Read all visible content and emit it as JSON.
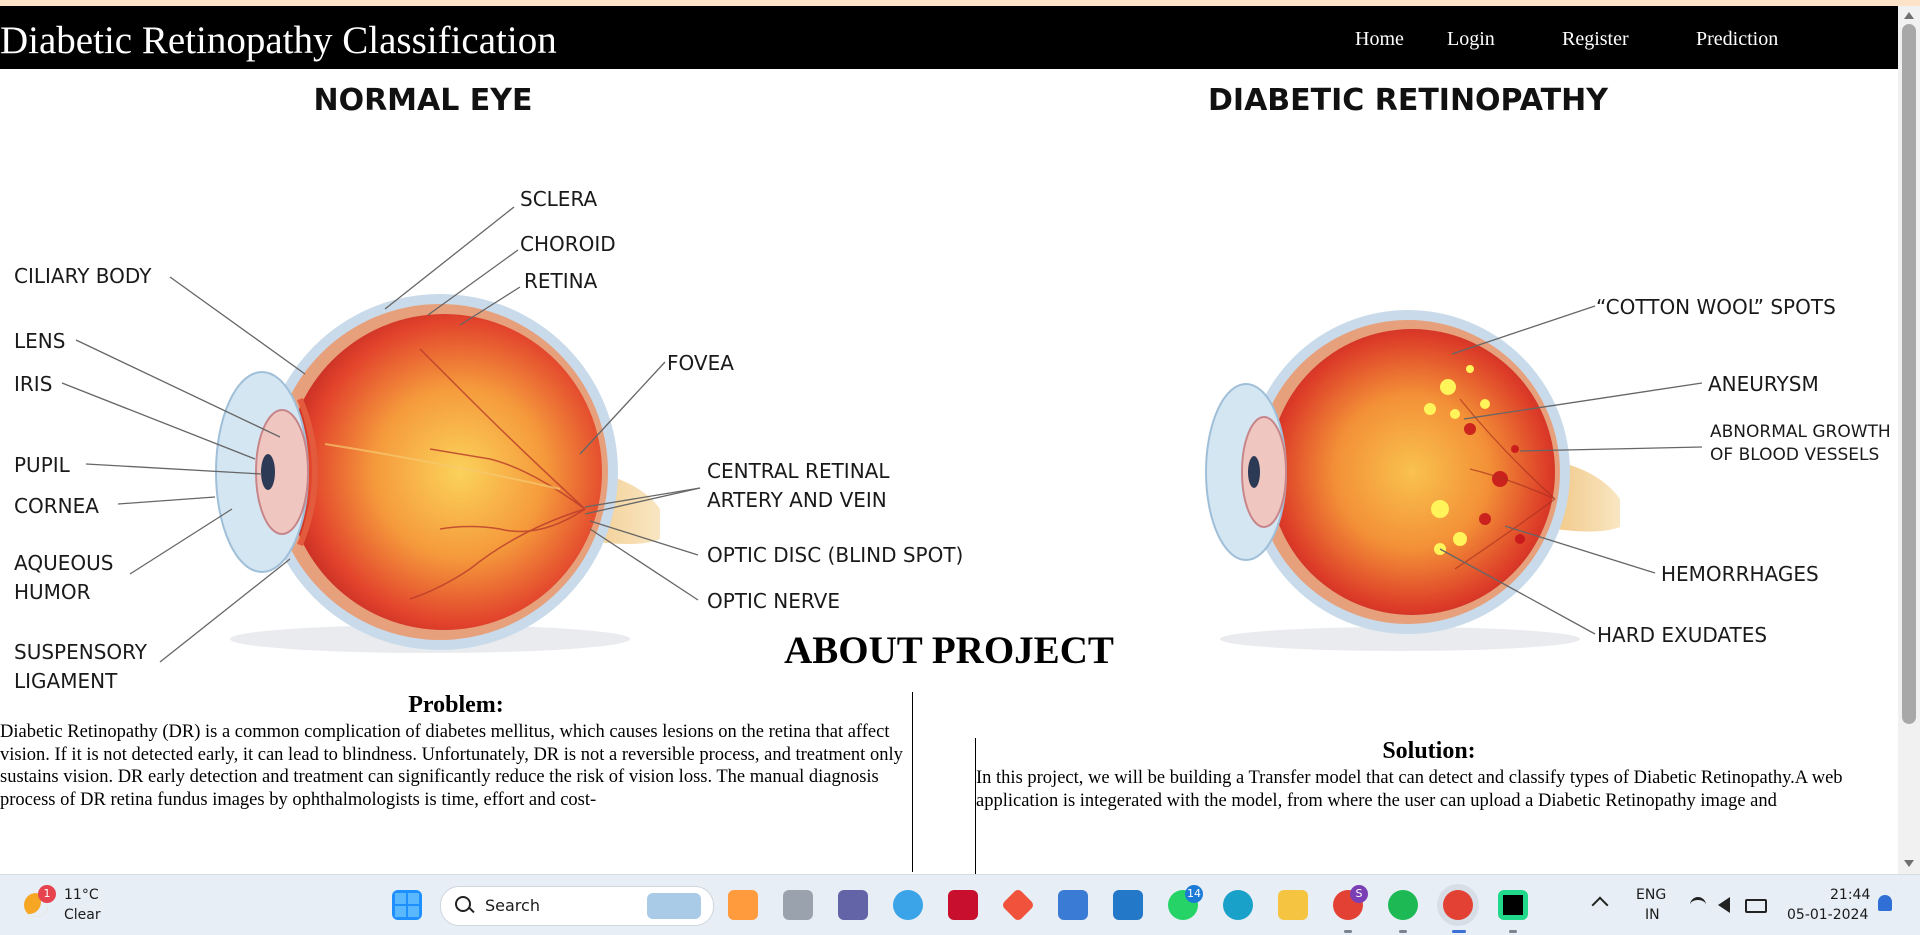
{
  "navbar": {
    "brand": "Diabetic Retinopathy Classification",
    "links": [
      "Home",
      "Login",
      "Register",
      "Prediction"
    ]
  },
  "diagram": {
    "normal_title": "NORMAL EYE",
    "dr_title": "DIABETIC RETINOPATHY",
    "normal_labels": {
      "sclera": "SCLERA",
      "choroid": "CHOROID",
      "retina": "RETINA",
      "ciliary_body": "CILIARY BODY",
      "lens": "LENS",
      "iris": "IRIS",
      "fovea": "FOVEA",
      "pupil": "PUPIL",
      "cornea": "CORNEA",
      "central_retinal_1": "CENTRAL RETINAL",
      "central_retinal_2": "ARTERY AND VEIN",
      "aqueous_1": "AQUEOUS",
      "aqueous_2": "HUMOR",
      "optic_disc": "OPTIC DISC (BLIND SPOT)",
      "optic_nerve": "OPTIC NERVE",
      "suspensory_1": "SUSPENSORY",
      "suspensory_2": "LIGAMENT"
    },
    "dr_labels": {
      "cotton_wool": "“COTTON WOOL” SPOTS",
      "aneurysm": "ANEURYSM",
      "abnormal_1": "ABNORMAL GROWTH",
      "abnormal_2": "OF BLOOD VESSELS",
      "hemorrhages": "HEMORRHAGES",
      "hard_exudates": "HARD EXUDATES"
    }
  },
  "about": {
    "title": "ABOUT PROJECT",
    "problem_title": "Problem:",
    "problem_text": "Diabetic Retinopathy (DR) is a common complication of diabetes mellitus, which causes lesions on the retina that affect vision. If it is not detected early, it can lead to blindness. Unfortunately, DR is not a reversible process, and treatment only sustains vision. DR early detection and treatment can significantly reduce the risk of vision loss. The manual diagnosis process of DR retina fundus images by ophthalmologists is time, effort and cost-",
    "solution_title": "Solution:",
    "solution_text": "In this project, we will be building a Transfer model that can detect and classify types of Diabetic Retinopathy.A web application is integerated with the model, from where the user can upload a Diabetic Retinopathy image and"
  },
  "taskbar": {
    "weather_temp": "11°C",
    "weather_cond": "Clear",
    "weather_badge": "1",
    "search_label": "Search",
    "whatsapp_badge": "14",
    "chrome_badge": "S",
    "lang_1": "ENG",
    "lang_2": "IN",
    "time": "21:44",
    "date": "05-01-2024"
  },
  "colors": {
    "navbar_bg": "#000000",
    "top_strip": "#fde3c8",
    "taskbar_bg": "#e8eef5"
  }
}
